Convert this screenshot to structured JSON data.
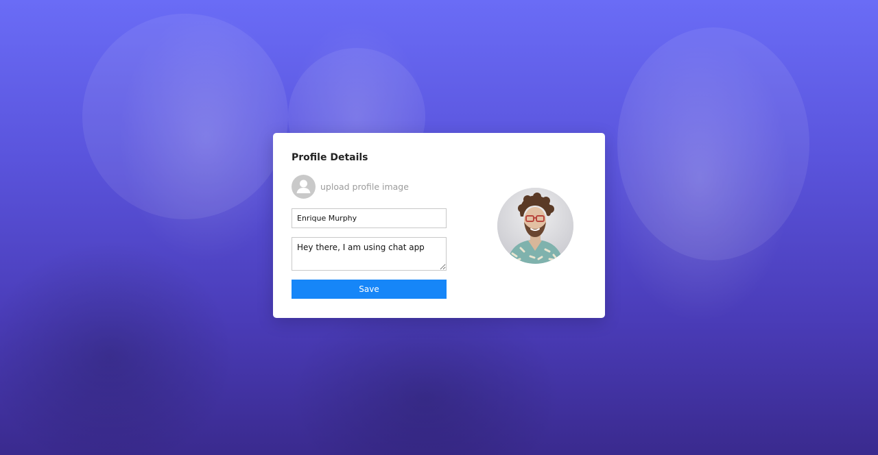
{
  "card": {
    "title": "Profile Details",
    "upload_label": "upload profile image",
    "name_value": "Enrique Murphy",
    "status_value": "Hey there, I am using chat app",
    "save_label": "Save"
  },
  "icons": {
    "upload_avatar": "user-placeholder-icon",
    "profile_photo": "profile-photo"
  },
  "colors": {
    "background_top": "#6a6cf6",
    "background_bottom": "#3a2a8e",
    "card_background": "#ffffff",
    "save_button": "#1686f8",
    "placeholder_avatar": "#c9c9c9"
  }
}
